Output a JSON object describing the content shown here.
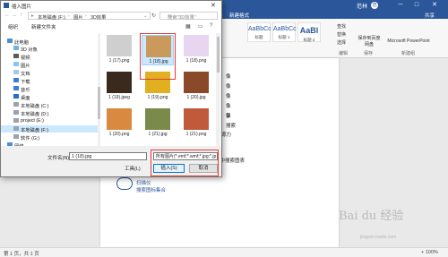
{
  "word": {
    "user": "范林",
    "user_initial": "范",
    "tabs": {
      "new_format": "新建格式",
      "share": "共享"
    },
    "styles": [
      {
        "sample": "AaBbCc",
        "name": "标题"
      },
      {
        "sample": "AaBbCc",
        "name": "标题 1"
      },
      {
        "sample": "AaBl",
        "name": "标题 2"
      }
    ],
    "ribbon_buttons": {
      "find": "查找",
      "replace": "替换",
      "select": "选择",
      "save_to_baidu": "保存到百度网盘",
      "ppt": "Microsoft PowerPoint"
    },
    "ribbon_groups": {
      "editing": "编辑",
      "save": "保存",
      "new_group": "新建组"
    },
    "doc_lines": [
      "像",
      "像",
      "像",
      "像",
      "像",
      "搜索"
    ],
    "doc_fragments": {
      "line1": "享",
      "line2": "源力",
      "line3": "库中搜索图表"
    },
    "cloud_lines": [
      "扫描仪",
      "搜索图标集合"
    ],
    "status": {
      "pages": "第 1 页，共 1 页",
      "zoom": "+ 100%"
    },
    "watermark": "Bai du 经验",
    "watermark_sub": "jingyan.baidu.com"
  },
  "dialog": {
    "title": "插入图片",
    "breadcrumb": [
      "本地磁盘 (F:)",
      "图片",
      "3D效果"
    ],
    "search_placeholder": "搜索\"3D效果\"",
    "toolbar": {
      "organize": "组织",
      "new_folder": "新建文件夹"
    },
    "nav_items": [
      {
        "label": "此电脑",
        "top": true,
        "icon": "computer-icon"
      },
      {
        "label": "3D 对象",
        "icon": "3d-objects-icon"
      },
      {
        "label": "视频",
        "icon": "video-icon"
      },
      {
        "label": "图片",
        "icon": "pictures-icon"
      },
      {
        "label": "文档",
        "icon": "documents-icon"
      },
      {
        "label": "下载",
        "icon": "download-icon"
      },
      {
        "label": "音乐",
        "icon": "music-icon"
      },
      {
        "label": "桌面",
        "icon": "desktop-icon"
      },
      {
        "label": "本地磁盘 (C:)",
        "icon": "drive-icon"
      },
      {
        "label": "本地磁盘 (D:)",
        "icon": "drive-icon"
      },
      {
        "label": "project (E:)",
        "icon": "drive-icon"
      },
      {
        "label": "本地磁盘 (F:)",
        "icon": "drive-icon",
        "selected": true
      },
      {
        "label": "软件 (G:)",
        "icon": "drive-icon"
      },
      {
        "label": "网络",
        "top": true,
        "icon": "network-icon"
      }
    ],
    "files": [
      {
        "name": "1 (17).png",
        "color": "#cfcfcf"
      },
      {
        "name": "1 (18).jpg",
        "color": "#c99a5b",
        "selected": true
      },
      {
        "name": "1 (18).png",
        "color": "#e8d5f0"
      },
      {
        "name": "1 (19).jpeg",
        "color": "#3a2a1e"
      },
      {
        "name": "1 (19).png",
        "color": "#e0b020"
      },
      {
        "name": "1 (20).jpg",
        "color": "#8a4a2a"
      },
      {
        "name": "1 (20).png",
        "color": "#d98a40"
      },
      {
        "name": "1 (21).jpg",
        "color": "#7a8a4a"
      },
      {
        "name": "1 (21).png",
        "color": "#c05a3a"
      }
    ],
    "filename_label": "文件名(N):",
    "filename_value": "1 (18).jpg",
    "filetype_value": "所有图片(*.emf;*.wmf;*.jpg;*.jp",
    "tools_label": "工具(L)",
    "insert_label": "插入(S)",
    "cancel_label": "取消"
  },
  "colors": {
    "word_blue": "#2b579a",
    "selection": "#cce8ff",
    "highlight_red": "#e23b3b"
  }
}
